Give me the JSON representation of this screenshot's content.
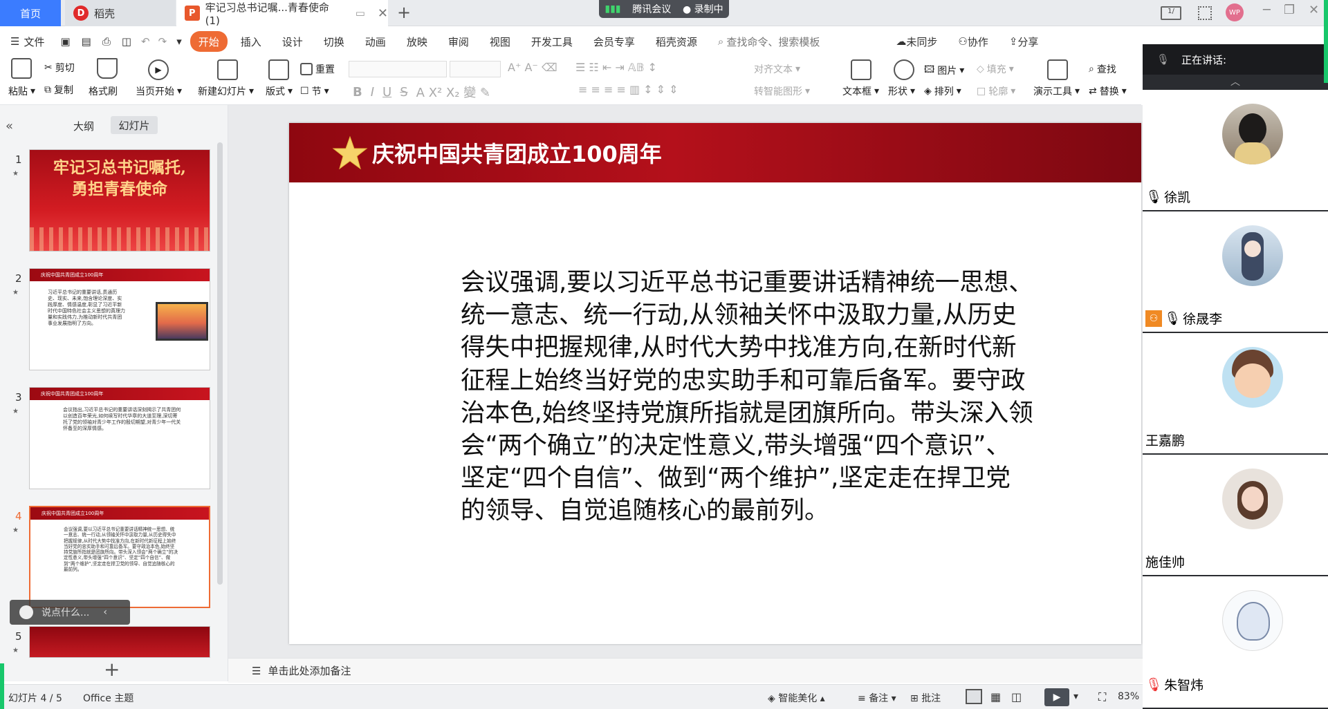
{
  "titlebar": {
    "tabs": [
      {
        "label": "首页"
      },
      {
        "label": "稻壳"
      },
      {
        "label": "牢记习总书记嘱...青春使命(1)"
      }
    ],
    "add_tab": "+",
    "avatar_text": "WP"
  },
  "meeting": {
    "app_name": "腾讯会议",
    "recording": "录制中",
    "speaking_label": "正在讲话:",
    "participants": [
      {
        "name": "徐凯"
      },
      {
        "name": "徐晟李"
      },
      {
        "name": "王嘉鹏"
      },
      {
        "name": "施佳帅"
      },
      {
        "name": "朱智炜"
      }
    ]
  },
  "menu": {
    "file": "文件",
    "items": [
      "开始",
      "插入",
      "设计",
      "切换",
      "动画",
      "放映",
      "审阅",
      "视图",
      "开发工具",
      "会员专享",
      "稻壳资源"
    ],
    "search_placeholder": "查找命令、搜索模板",
    "right": [
      "未同步",
      "协作",
      "分享"
    ]
  },
  "ribbon": {
    "paste": "粘贴",
    "cut": "剪切",
    "copy": "复制",
    "format_painter": "格式刷",
    "play_from_current": "当页开始",
    "new_slide": "新建幻灯片",
    "layout": "版式",
    "reset": "重置",
    "section": "节",
    "align_text": "对齐文本",
    "smart_shape": "转智能图形",
    "textbox": "文本框",
    "shape": "形状",
    "picture": "图片",
    "fill": "填充",
    "arrange": "排列",
    "outline": "轮廓",
    "present_tools": "演示工具",
    "find": "查找",
    "replace": "替换"
  },
  "leftpanel": {
    "tab_outline": "大纲",
    "tab_slides": "幻灯片",
    "slides": [
      {
        "num": "1",
        "title_line1": "牢记习总书记嘱托,",
        "title_line2": "勇担青春使命"
      },
      {
        "num": "2",
        "header": "庆祝中国共青团成立100周年",
        "text": "习近平总书记的重要讲话,贯通历史、现实、未来,饱含理论深度、实践厚度、情感温度,彰显了习近平新时代中国特色社会主义思想的真理力量和实践伟力,为推动新时代共青团事业发展指明了方向。"
      },
      {
        "num": "3",
        "header": "庆祝中国共青团成立100周年",
        "text": "会议指出,习近平总书记的重要讲话深刻揭示了共青团何以创造百年荣光,如何续写时代华章的大道至理,深切寄托了党的领袖对青少年工作的殷切期望,对青少年一代关怀备至的深厚情感。"
      },
      {
        "num": "4",
        "header": "庆祝中国共青团成立100周年",
        "text": "会议强调,要以习近平总书记重要讲话精神统一思想、统一意志、统一行动,从领袖关怀中汲取力量,从历史得失中把握规律,从时代大势中找准方向,在新时代新征程上始终当好党的忠实助手和可靠后备军。要守政治本色,始终坚持党旗所指就是团旗所向。带头深入领会“两个确立”的决定性意义,带头增强“四个意识”、坚定“四个自信”、做到“两个维护”,坚定走在捍卫党的领导、自觉追随核心的最前列。"
      },
      {
        "num": "5"
      }
    ],
    "add": "+"
  },
  "chat": {
    "placeholder": "说点什么..."
  },
  "slide": {
    "title": "庆祝中国共青团成立100周年",
    "body": "会议强调,要以习近平总书记重要讲话精神统一思想、统一意志、统一行动,从领袖关怀中汲取力量,从历史得失中把握规律,从时代大势中找准方向,在新时代新征程上始终当好党的忠实助手和可靠后备军。要守政治本色,始终坚持党旗所指就是团旗所向。带头深入领会“两个确立”的决定性意义,带头增强“四个意识”、坚定“四个自信”、做到“两个维护”,坚定走在捍卫党的领导、自觉追随核心的最前列。"
  },
  "notes": {
    "placeholder": "单击此处添加备注"
  },
  "status": {
    "slide_counter": "幻灯片 4 / 5",
    "theme": "Office 主题",
    "beautify": "智能美化",
    "notes": "备注",
    "comments": "批注",
    "zoom": "83%"
  },
  "colors": {
    "accent": "#ee6b34",
    "home_tab": "#3b7cff",
    "slide_red": "#b4101b",
    "meeting_green": "#18c76b"
  }
}
